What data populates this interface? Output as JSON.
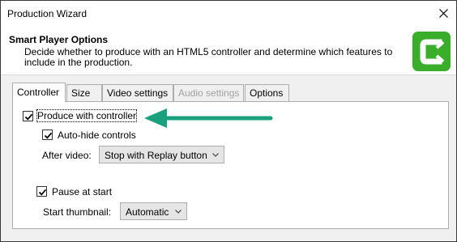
{
  "window": {
    "title": "Production Wizard",
    "close_icon": "close-icon"
  },
  "header": {
    "title": "Smart Player Options",
    "description": "Decide whether to produce with an HTML5 controller and determine which features to include in the production.",
    "logo_icon": "camtasia-logo-icon",
    "logo_color": "#3aae2a"
  },
  "tabs": [
    {
      "label": "Controller",
      "active": true,
      "disabled": false
    },
    {
      "label": "Size",
      "active": false,
      "disabled": false
    },
    {
      "label": "Video settings",
      "active": false,
      "disabled": false
    },
    {
      "label": "Audio settings",
      "active": false,
      "disabled": true
    },
    {
      "label": "Options",
      "active": false,
      "disabled": false
    }
  ],
  "controller": {
    "produce_with_controller": {
      "label": "Produce with controller",
      "checked": true
    },
    "auto_hide_controls": {
      "label": "Auto-hide controls",
      "checked": true
    },
    "after_video": {
      "label": "After video:",
      "value": "Stop with Replay button"
    },
    "pause_at_start": {
      "label": "Pause at start",
      "checked": true
    },
    "start_thumbnail": {
      "label": "Start thumbnail:",
      "value": "Automatic"
    }
  },
  "annotation": {
    "arrow_color": "#1aa07c",
    "arrow_icon": "arrow-left-icon"
  }
}
